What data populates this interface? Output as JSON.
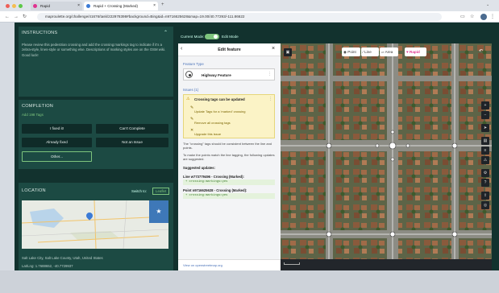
{
  "browser": {
    "tabs": [
      {
        "label": "Rapid",
        "active": false
      },
      {
        "label": "Rapid + Crossing (Marked)",
        "active": true
      }
    ],
    "url": "maproulette.org/challenge/41676/task/222978398#background=Bing&id=n9716625628&map=19.00/40.77293/-111.86622"
  },
  "instructions": {
    "title": "INSTRUCTIONS",
    "body": "Please review this pedestrian crossing and add the crossing:markings tag to indicate if it's a zebra-style, lines-style or something else. Descriptions of marking styles are on the OSM wiki. Good luck!"
  },
  "completion": {
    "title": "COMPLETION",
    "sub": "Add 198 Tags",
    "buttons": {
      "fixed": "I fixed it!",
      "cant": "Can't Complete",
      "already": "Already fixed",
      "not_issue": "Not an Issue",
      "other": "Other..."
    }
  },
  "location": {
    "title": "LOCATION",
    "switch_label": "Switch to:",
    "switch_btn": "Leaflet",
    "address": "Salt Lake City, Salt Lake County, Utah, United States",
    "coords": "Lat/Lng: 1.7688652, -40.7729937"
  },
  "mode": {
    "label": "Current Mode:",
    "value": "Edit Mode"
  },
  "editor": {
    "title": "Edit feature",
    "feature_type_label": "Feature Type",
    "feature_type_value": "Highway Feature",
    "issues_label": "Issues (1)",
    "warning_title": "Crossing tags can be updated",
    "warning_items": [
      "Update Tags for a 'marked' crossing",
      "Remove all crossing tags",
      "Upgrade this issue"
    ],
    "note": "The \"crossing\" tags should be consistent between the line and points.",
    "note2": "To make the points match the line tagging, the following updates are suggested.",
    "suggested_label": "Suggested updates:",
    "line_label": "Line w773779496 - Crossing (Marked):",
    "line_code": "+ crossing:markings=yes",
    "point_label": "Point n9716625628 - Crossing (Marked):",
    "point_code": "+ crossing:markings=yes",
    "footer_link": "View on openstreetmap.org"
  },
  "map": {
    "buttons": {
      "point": "Point",
      "line": "Line",
      "area": "Area",
      "rapid": "Rapid"
    }
  },
  "colors": {
    "accent": "#7dc47d",
    "panel": "#1c4a43",
    "app_bg": "#12322e"
  }
}
